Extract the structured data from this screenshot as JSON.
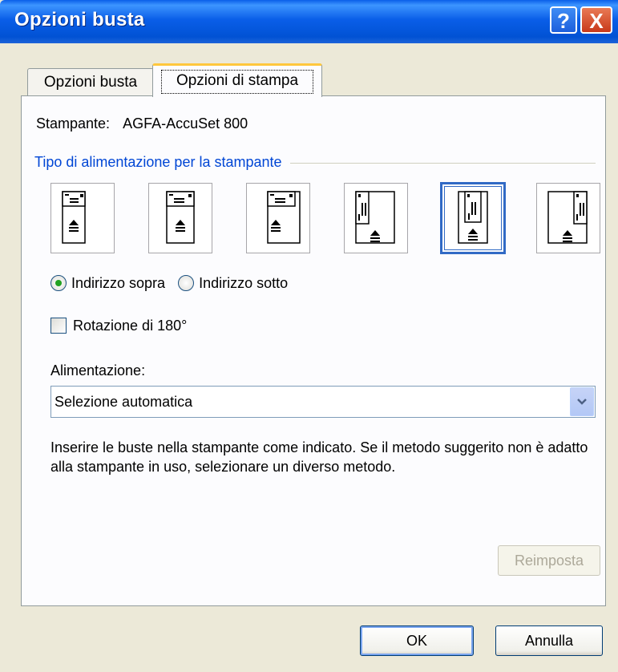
{
  "window": {
    "title": "Opzioni busta",
    "help_glyph": "?",
    "close_glyph": "X"
  },
  "tabs": [
    {
      "label": "Opzioni busta",
      "active": false
    },
    {
      "label": "Opzioni di stampa",
      "active": true
    }
  ],
  "printer": {
    "label": "Stampante:",
    "value": "AGFA-AccuSet 800"
  },
  "feed_group": {
    "label": "Tipo di alimentazione per la stampante",
    "methods": [
      {
        "icon": "envelope-landscape-left-icon",
        "selected": false
      },
      {
        "icon": "envelope-landscape-center-icon",
        "selected": false
      },
      {
        "icon": "envelope-landscape-right-icon",
        "selected": false
      },
      {
        "icon": "envelope-portrait-left-icon",
        "selected": false
      },
      {
        "icon": "envelope-portrait-center-icon",
        "selected": true
      },
      {
        "icon": "envelope-portrait-right-icon",
        "selected": false
      }
    ]
  },
  "face": {
    "options": [
      {
        "label": "Indirizzo sopra",
        "checked": true
      },
      {
        "label": "Indirizzo sotto",
        "checked": false
      }
    ]
  },
  "rotation": {
    "label": "Rotazione di 180°",
    "checked": false
  },
  "feed_source": {
    "label": "Alimentazione:",
    "value": "Selezione automatica"
  },
  "info_text": "Inserire le buste nella stampante come indicato. Se il metodo suggerito non è adatto alla stampante in uso, selezionare un diverso metodo.",
  "buttons": {
    "reset": "Reimposta",
    "ok": "OK",
    "cancel": "Annulla"
  },
  "colors": {
    "titlebar": "#0a5ee8",
    "group_label": "#0046d5",
    "selection": "#316ac5"
  }
}
